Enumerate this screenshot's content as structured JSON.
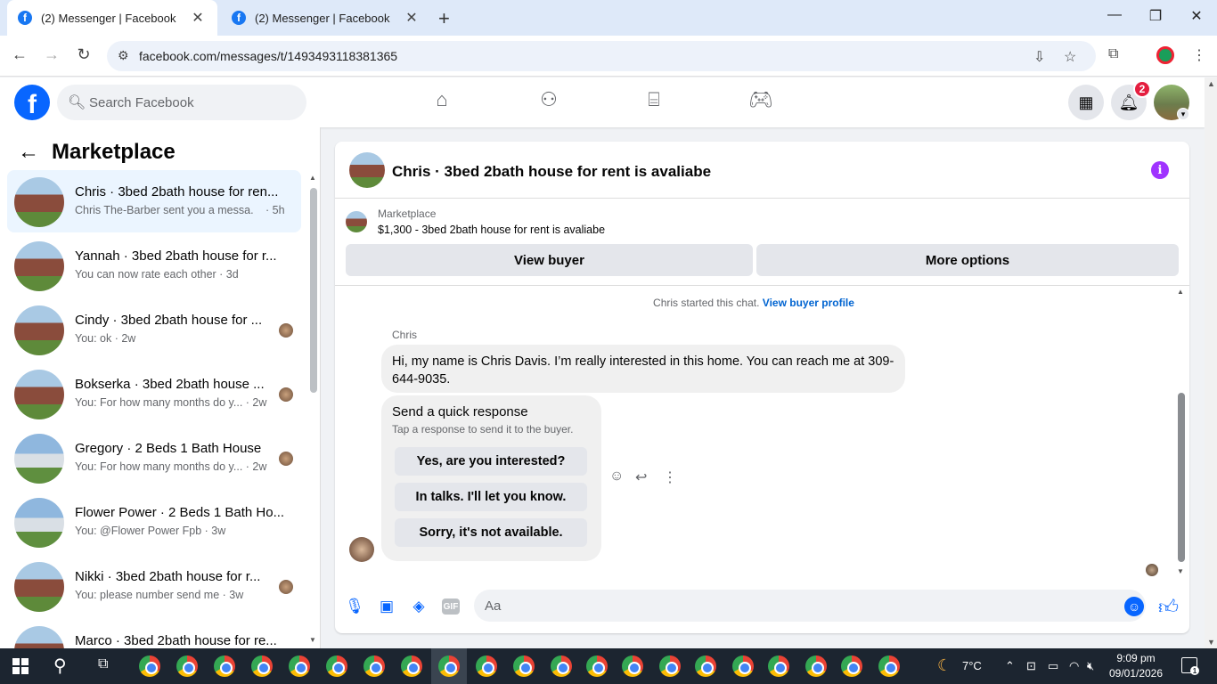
{
  "browser": {
    "tabs": [
      {
        "title": "(2) Messenger | Facebook",
        "active": true
      },
      {
        "title": "(2) Messenger | Facebook",
        "active": false
      }
    ],
    "url": "facebook.com/messages/t/1493493118381365"
  },
  "header": {
    "search_placeholder": "Search Facebook",
    "notification_count": "2"
  },
  "sidebar": {
    "title": "Marketplace",
    "conversations": [
      {
        "name": "Chris · 3bed 2bath house for ren...",
        "preview": "Chris The-Barber sent you a messa...",
        "time": "· 5h",
        "selected": true
      },
      {
        "name": "Yannah · 3bed 2bath house for r...",
        "preview": "You can now rate each other · 3d"
      },
      {
        "name": "Cindy · 3bed 2bath house for ...",
        "preview": "You: ok · 2w"
      },
      {
        "name": "Bokserka · 3bed 2bath house ...",
        "preview": "You: For how many months do y... · 2w"
      },
      {
        "name": "Gregory · 2 Beds 1 Bath House",
        "preview": "You: For how many months do y... · 2w"
      },
      {
        "name": "Flower Power · 2 Beds 1 Bath Ho...",
        "preview": "You: @Flower Power Fpb · 3w"
      },
      {
        "name": "Nikki · 3bed 2bath house for r...",
        "preview": "You: please number send me · 3w"
      },
      {
        "name": "Marco · 3bed 2bath house for re..."
      }
    ]
  },
  "chat": {
    "title": "Chris · 3bed 2bath house for rent is avaliabe",
    "marketplace_label": "Marketplace",
    "listing": "$1,300 - 3bed 2bath house for rent is avaliabe",
    "view_buyer": "View buyer",
    "more_options": "More options",
    "started_text": "Chris started this chat.",
    "view_buyer_profile": "View buyer profile",
    "sender": "Chris",
    "message": "Hi, my name is Chris Davis. I’m really interested in this home. You can reach me at 309-644-9035.",
    "quick_response_title": "Send a quick response",
    "quick_response_sub": "Tap a response to send it to the buyer.",
    "quick_responses": [
      "Yes, are you interested?",
      "In talks. I'll let you know.",
      "Sorry, it's not available."
    ],
    "input_placeholder": "Aa"
  },
  "taskbar": {
    "temperature": "7°C",
    "time": "9:09 pm",
    "date": "09/01/2026",
    "notification_count": "1"
  }
}
